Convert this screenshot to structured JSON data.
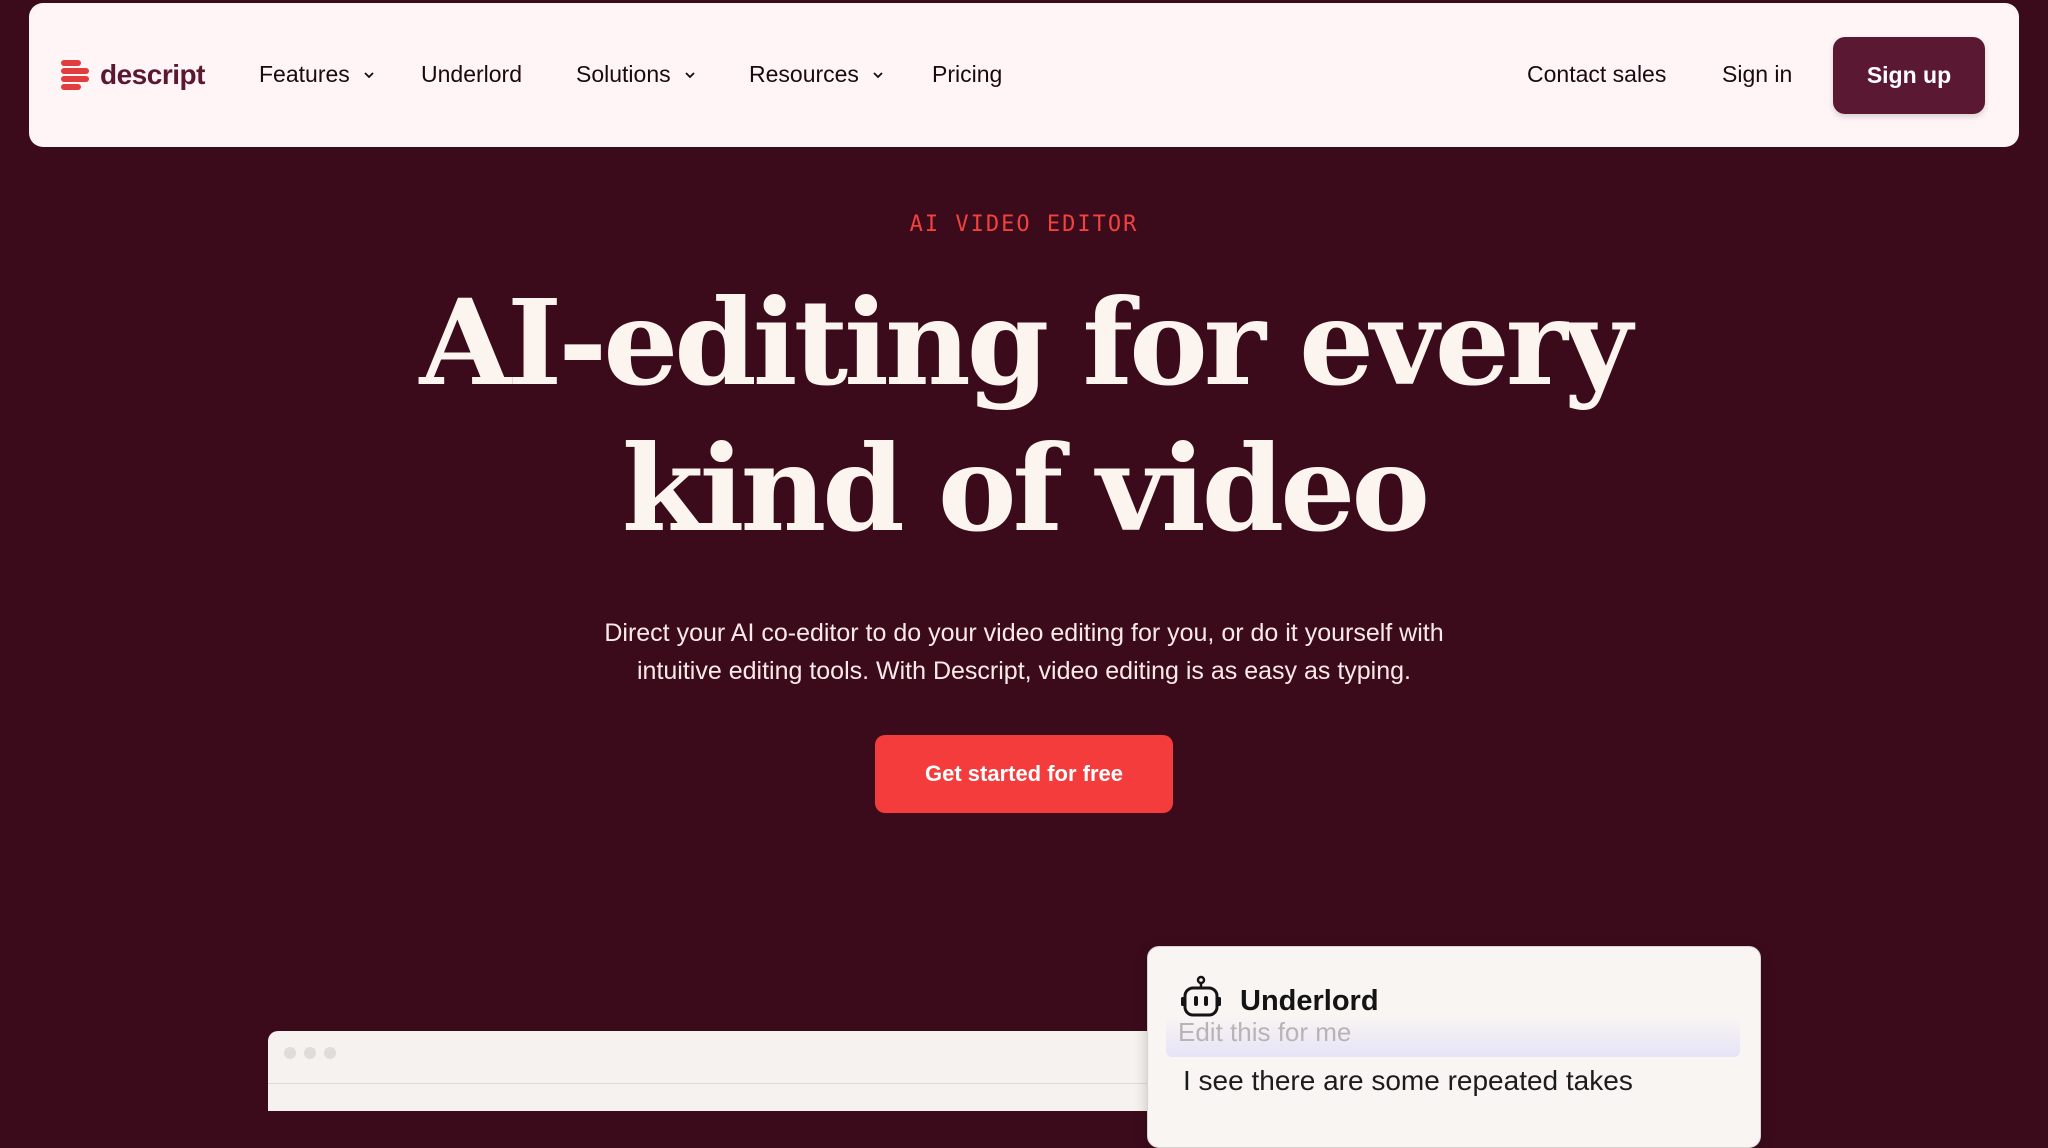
{
  "nav": {
    "logo_text": "descript",
    "links": [
      {
        "label": "Features",
        "has_dropdown": true
      },
      {
        "label": "Underlord",
        "has_dropdown": false
      },
      {
        "label": "Solutions",
        "has_dropdown": true
      },
      {
        "label": "Resources",
        "has_dropdown": true
      },
      {
        "label": "Pricing",
        "has_dropdown": false
      }
    ],
    "contact_sales": "Contact sales",
    "sign_in": "Sign in",
    "sign_up": "Sign up"
  },
  "hero": {
    "eyebrow": "AI VIDEO EDITOR",
    "headline_line1": "AI-editing for every",
    "headline_line2": "kind of video",
    "subhead_line1": "Direct your AI co-editor to do your video editing for you, or do it yourself with",
    "subhead_line2": "intuitive editing tools. With Descript, video editing is as easy as typing.",
    "cta": "Get started for free"
  },
  "underlord_card": {
    "title": "Underlord",
    "faded_prompt": "Edit this for me",
    "response": "I see there are some repeated takes"
  },
  "colors": {
    "background": "#3b0b1c",
    "nav_background": "#fff5f7",
    "accent": "#f43c3c",
    "brand": "#5a1832"
  }
}
